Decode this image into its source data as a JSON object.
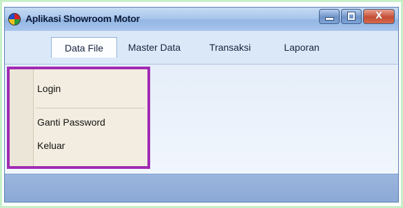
{
  "window": {
    "title": "Aplikasi Showroom Motor",
    "controls": {
      "minimize_icon": "minimize-icon",
      "maximize_icon": "maximize-icon",
      "close_label": "X"
    }
  },
  "menubar": {
    "items": [
      {
        "label": "Data File",
        "active": true
      },
      {
        "label": "Master Data",
        "active": false
      },
      {
        "label": "Transaksi",
        "active": false
      },
      {
        "label": "Laporan",
        "active": false
      }
    ]
  },
  "dropdown": {
    "items": [
      {
        "label": "Login"
      },
      {
        "label": "Ganti Password"
      },
      {
        "label": "Keluar"
      }
    ]
  },
  "colors": {
    "highlight_border": "#a12ab4",
    "titlebar": "#a9c6ec",
    "statusbar": "#8aa8d5"
  }
}
